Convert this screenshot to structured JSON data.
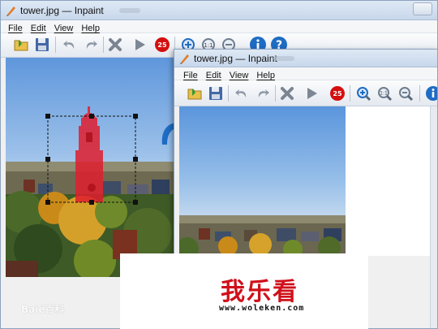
{
  "back_window": {
    "title": "tower.jpg — Inpaint",
    "menu": [
      {
        "label": "File"
      },
      {
        "label": "Edit"
      },
      {
        "label": "View"
      },
      {
        "label": "Help"
      }
    ],
    "toolbar": {
      "counter_badge": "25"
    }
  },
  "front_window": {
    "title": "tower.jpg — Inpaint",
    "menu": [
      {
        "label": "File"
      },
      {
        "label": "Edit"
      },
      {
        "label": "View"
      },
      {
        "label": "Help"
      }
    ],
    "toolbar": {
      "counter_badge": "25"
    }
  },
  "watermarks": {
    "logo_text": "我乐看",
    "site_url": "www.woleken.com",
    "corner_logo": "Baié百科"
  },
  "colors": {
    "accent_blue": "#1f6cc4",
    "selection_red": "#e01e2e",
    "logo_red": "#d0101a"
  }
}
